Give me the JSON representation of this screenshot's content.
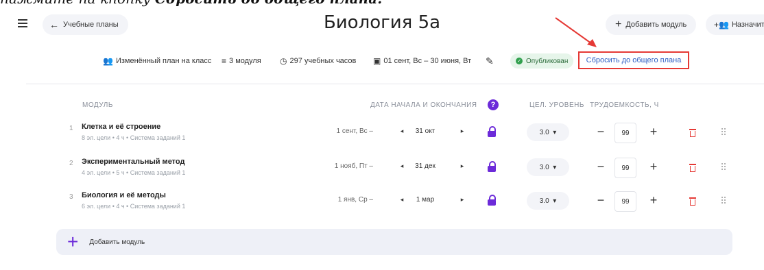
{
  "caption": {
    "prefix": "нажмите на кнопку ",
    "emph": "Сбросить до общего плана."
  },
  "header": {
    "back_label": "Учебные планы",
    "title": "Биология 5а",
    "add_module_label": "Добавить модуль",
    "assign_label": "Назначить"
  },
  "meta": {
    "plan_type": "Изменённый план на класс",
    "modules_count": "3 модуля",
    "hours": "297 учебных часов",
    "dates": "01 сент, Вс – 30 июня, Вт",
    "status": "Опубликован",
    "reset_label": "Сбросить до общего плана"
  },
  "columns": {
    "module": "МОДУЛЬ",
    "dates": "ДАТА НАЧАЛА И ОКОНЧАНИЯ",
    "help": "?",
    "level": "ЦЕЛ. УРОВЕНЬ",
    "effort": "ТРУДОЕМКОСТЬ, Ч"
  },
  "rows": [
    {
      "num": "1",
      "title": "Клетка и её строение",
      "sub": "8 эл. цели • 4 ч • Система заданий 1",
      "start": "1 сент, Вс –",
      "end": "31 окт",
      "level": "3.0",
      "qty": "99"
    },
    {
      "num": "2",
      "title": "Экспериментальный метод",
      "sub": "4 эл. цели • 5 ч • Система заданий 1",
      "start": "1 нояб, Пт –",
      "end": "31 дек",
      "level": "3.0",
      "qty": "99"
    },
    {
      "num": "3",
      "title": "Биология и её методы",
      "sub": "6 эл. цели • 4 ч • Система заданий 1",
      "start": "1 янв, Ср –",
      "end": "1 мар",
      "level": "3.0",
      "qty": "99"
    }
  ],
  "footer": {
    "add_module_label": "Добавить модуль"
  },
  "colors": {
    "accent": "#6c2bd9",
    "danger": "#e53935",
    "link": "#2f5fc4",
    "success": "#31a04e"
  }
}
